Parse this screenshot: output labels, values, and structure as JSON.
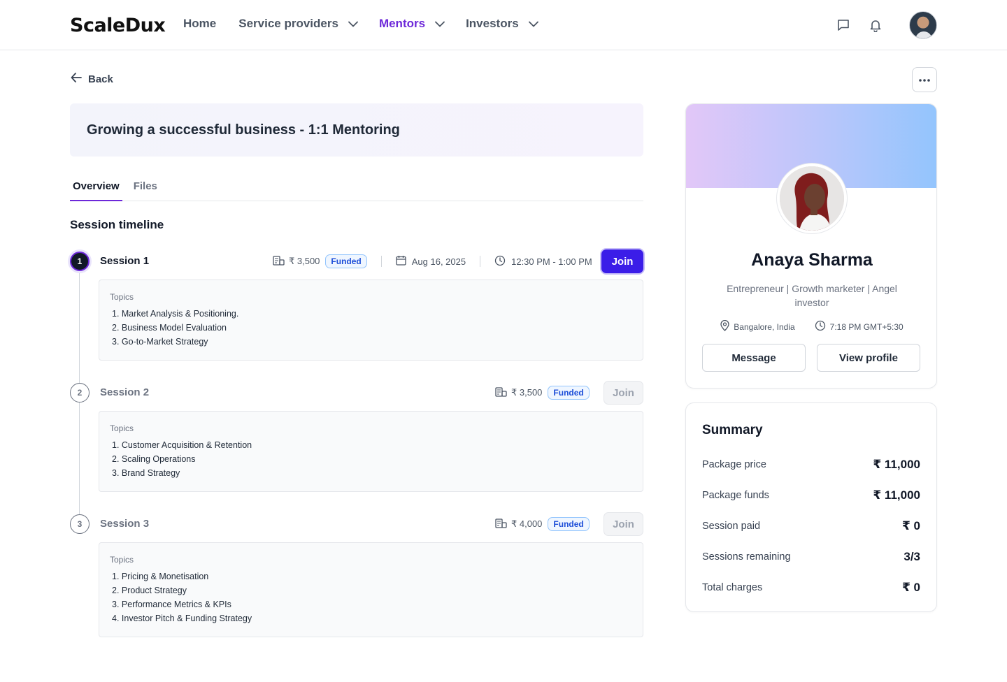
{
  "header": {
    "logo": "ScaleDux",
    "nav": [
      {
        "label": "Home",
        "dropdown": false,
        "active": false
      },
      {
        "label": "Service providers",
        "dropdown": true,
        "active": false
      },
      {
        "label": "Mentors",
        "dropdown": true,
        "active": true
      },
      {
        "label": "Investors",
        "dropdown": true,
        "active": false
      }
    ],
    "icons": [
      "message-icon",
      "bell-icon"
    ],
    "accent_color": "#6d28d9"
  },
  "back_label": "Back",
  "page_title": "Growing a successful business - 1:1 Mentoring",
  "tabs": [
    {
      "label": "Overview",
      "active": true
    },
    {
      "label": "Files",
      "active": false
    }
  ],
  "timeline_title": "Session timeline",
  "sessions": [
    {
      "number": "1",
      "title": "Session 1",
      "price": "₹ 3,500",
      "badge": "Funded",
      "date": "Aug 16, 2025",
      "time": "12:30 PM - 1:00 PM",
      "join_label": "Join",
      "join_enabled": true,
      "topics_label": "Topics",
      "topics": [
        "1. Market Analysis & Positioning.",
        "2. Business Model Evaluation",
        "3. Go-to-Market Strategy"
      ]
    },
    {
      "number": "2",
      "title": "Session 2",
      "price": "₹ 3,500",
      "badge": "Funded",
      "join_label": "Join",
      "join_enabled": false,
      "topics_label": "Topics",
      "topics": [
        "1. Customer Acquisition & Retention",
        "2. Scaling Operations",
        "3. Brand Strategy"
      ]
    },
    {
      "number": "3",
      "title": "Session 3",
      "price": "₹ 4,000",
      "badge": "Funded",
      "join_label": "Join",
      "join_enabled": false,
      "topics_label": "Topics",
      "topics": [
        "1. Pricing & Monetisation",
        "2. Product Strategy",
        "3. Performance Metrics & KPIs",
        "4. Investor Pitch & Funding Strategy"
      ]
    }
  ],
  "profile": {
    "name": "Anaya Sharma",
    "bio": "Entrepreneur | Growth marketer | Angel investor",
    "location": "Bangalore, India",
    "local_time": "7:18 PM GMT+5:30",
    "message_label": "Message",
    "view_profile_label": "View profile"
  },
  "summary": {
    "title": "Summary",
    "rows": [
      {
        "label": "Package price",
        "value": "₹ 11,000"
      },
      {
        "label": "Package funds",
        "value": "₹ 11,000"
      },
      {
        "label": "Session paid",
        "value": "₹ 0"
      },
      {
        "label": "Sessions remaining",
        "value": "3/3"
      },
      {
        "label": "Total charges",
        "value": "₹ 0"
      }
    ]
  }
}
